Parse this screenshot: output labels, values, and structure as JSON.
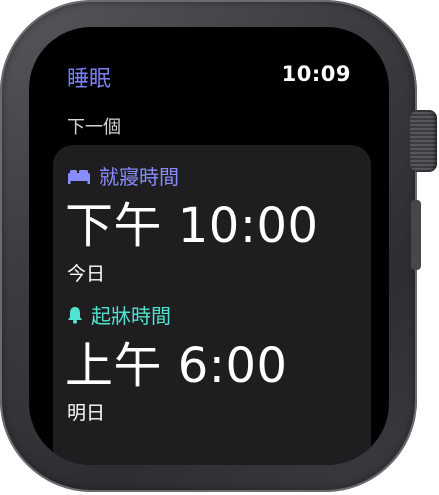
{
  "app": {
    "title": "睡眠",
    "time": "10:09"
  },
  "next_section": {
    "label": "下一個"
  },
  "bedtime": {
    "icon": "bed-icon",
    "label": "就寢時間",
    "time": "下午 10:00",
    "day": "今日",
    "color": "#8a8dff"
  },
  "wakeup": {
    "icon": "alarm-bell-icon",
    "label": "起牀時間",
    "time": "上午 6:00",
    "day": "明日",
    "color": "#52e3d0"
  }
}
